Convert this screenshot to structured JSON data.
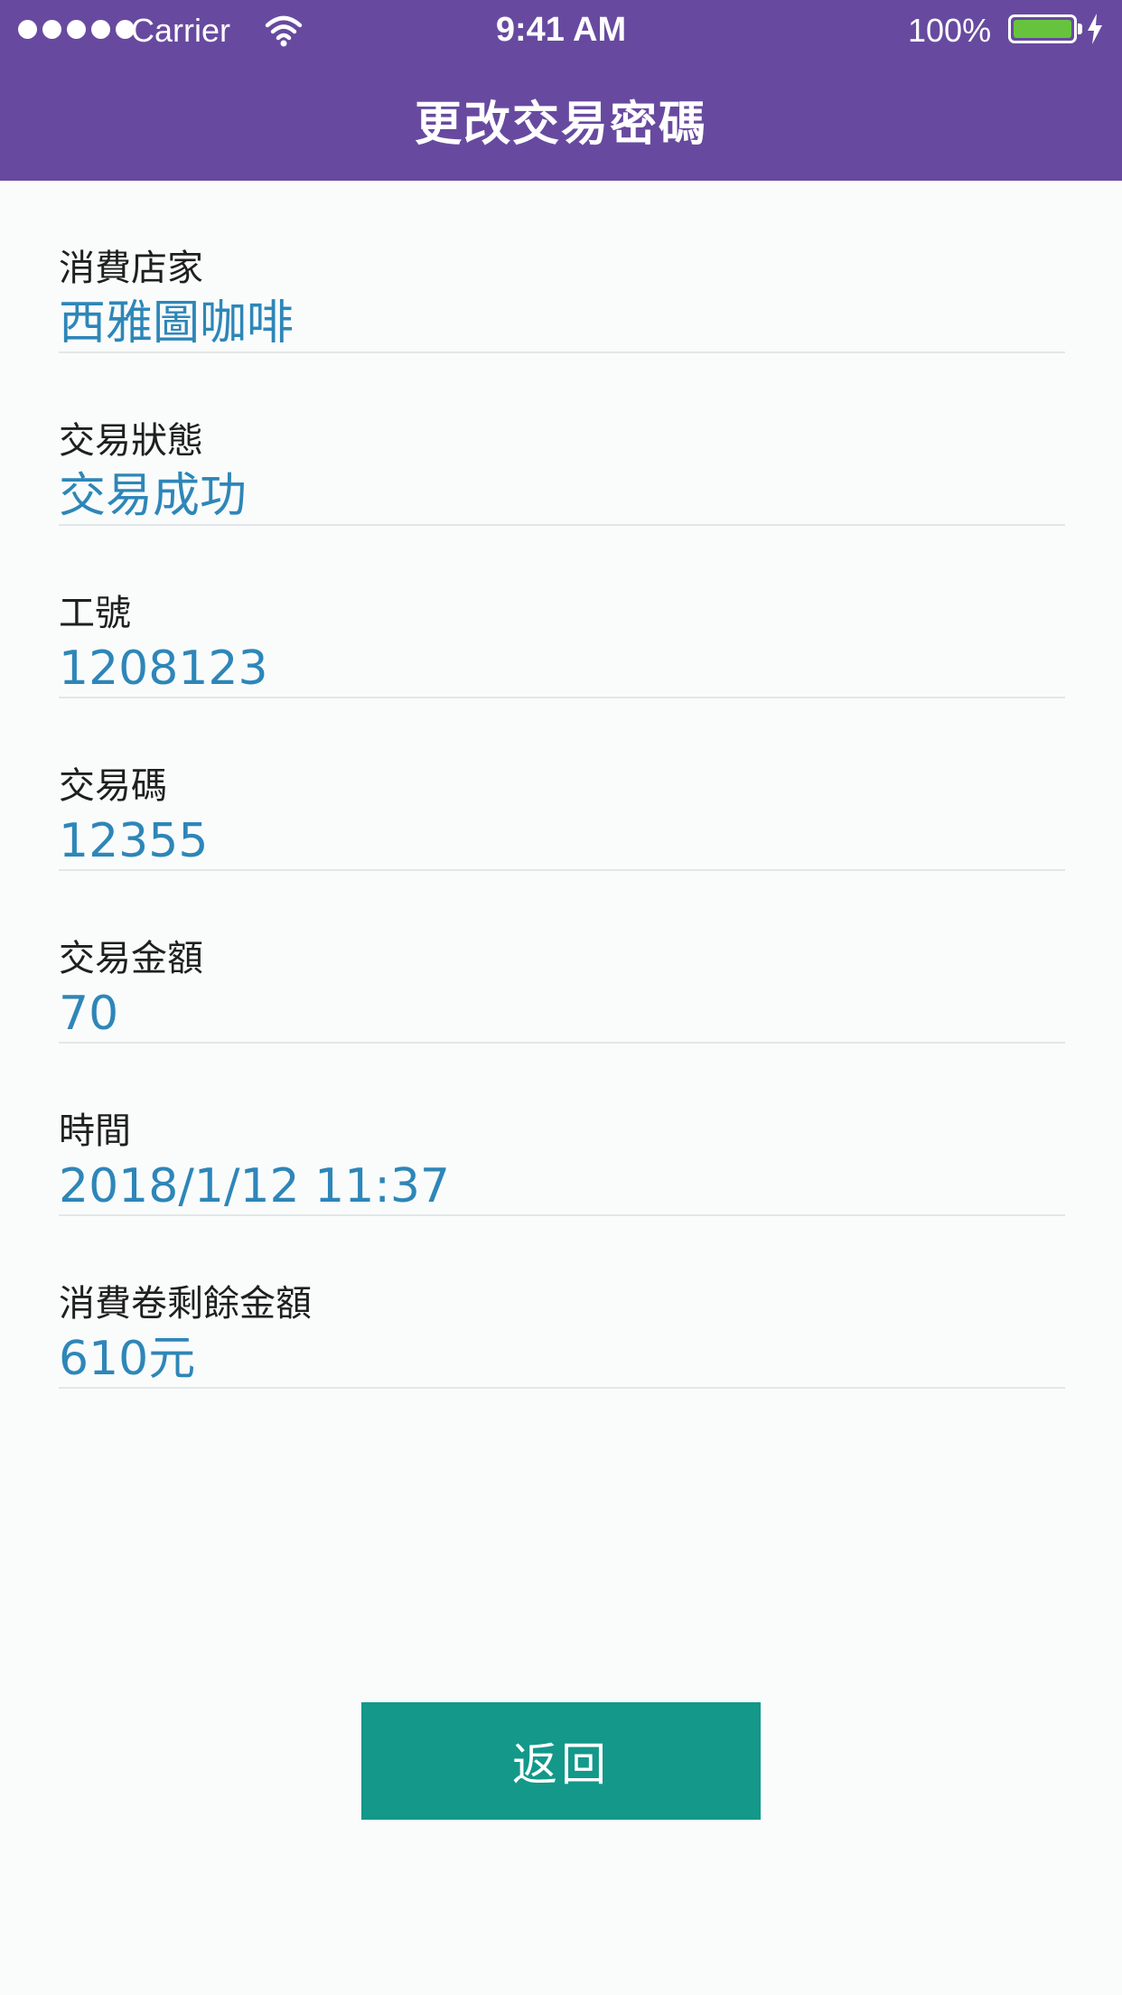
{
  "status_bar": {
    "carrier": "Carrier",
    "time": "9:41 AM",
    "battery": "100%",
    "signal_icon": "signal-dots-icon",
    "wifi_icon": "wifi-icon",
    "battery_icon": "battery-icon",
    "charging_icon": "lightning-bolt-icon",
    "battery_fill_color": "#67C33E"
  },
  "header": {
    "title": "更改交易密碼",
    "background_color": "#674A9F"
  },
  "details": [
    {
      "label": "消費店家",
      "value": "西雅圖咖啡"
    },
    {
      "label": "交易狀態",
      "value": "交易成功"
    },
    {
      "label": "工號",
      "value": "1208123"
    },
    {
      "label": "交易碼",
      "value": "12355"
    },
    {
      "label": "交易金額",
      "value": "70"
    },
    {
      "label": "時間",
      "value": "2018/1/12 11:37"
    },
    {
      "label": "消費卷剩餘金額",
      "value": "610元"
    }
  ],
  "footer": {
    "back_label": "返回",
    "button_color": "#13988A"
  },
  "colors": {
    "value_text": "#2E86B8",
    "label_text": "#1F1F1F",
    "divider": "#E2E6E8"
  }
}
